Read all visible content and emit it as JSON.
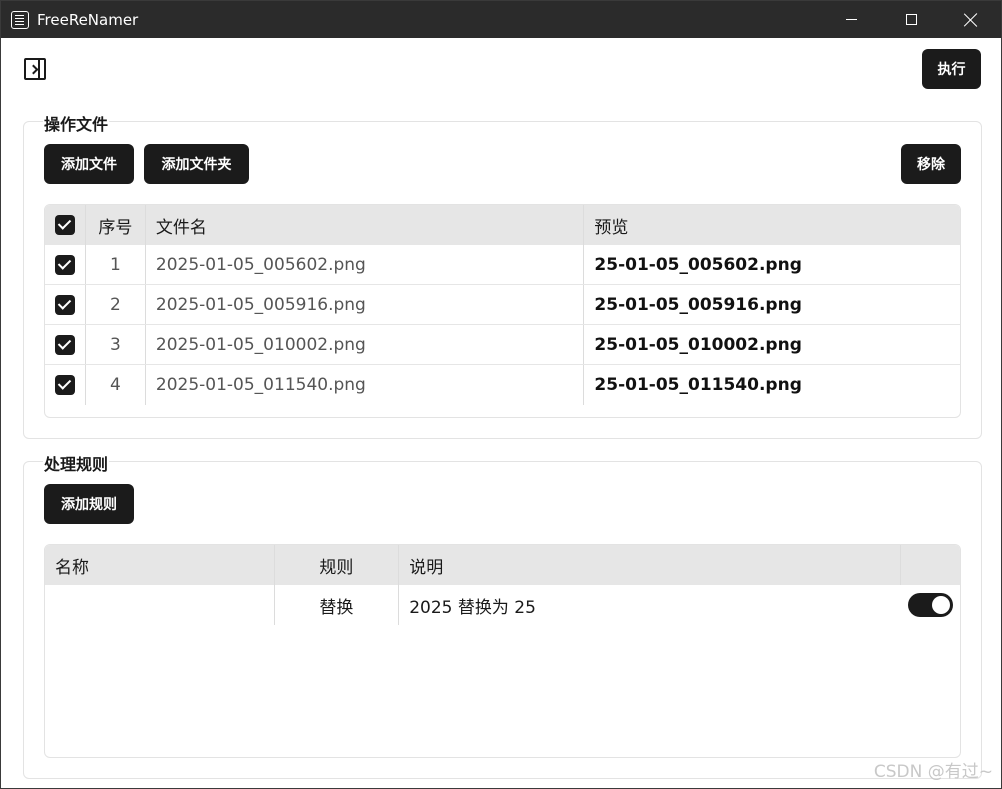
{
  "window": {
    "title": "FreeReNamer",
    "icon": "app-document-icon"
  },
  "toolbar": {
    "execute_label": "执行",
    "sidebar_icon": "sidebar-toggle-icon"
  },
  "files_group": {
    "title": "操作文件",
    "add_file_label": "添加文件",
    "add_folder_label": "添加文件夹",
    "remove_label": "移除",
    "table": {
      "headers": [
        "序号",
        "文件名",
        "预览"
      ],
      "rows": [
        {
          "checked": true,
          "index": "1",
          "name": "2025-01-05_005602.png",
          "preview": "25-01-05_005602.png"
        },
        {
          "checked": true,
          "index": "2",
          "name": "2025-01-05_005916.png",
          "preview": "25-01-05_005916.png"
        },
        {
          "checked": true,
          "index": "3",
          "name": "2025-01-05_010002.png",
          "preview": "25-01-05_010002.png"
        },
        {
          "checked": true,
          "index": "4",
          "name": "2025-01-05_011540.png",
          "preview": "25-01-05_011540.png"
        }
      ]
    }
  },
  "rules_group": {
    "title": "处理规则",
    "add_rule_label": "添加规则",
    "table": {
      "headers": [
        "名称",
        "规则",
        "说明"
      ],
      "rows": [
        {
          "name": "",
          "rule": "替换",
          "description": "2025 替换为 25",
          "enabled": true
        }
      ]
    }
  },
  "watermark": "CSDN @有过~",
  "colors": {
    "titlebar": "#2b2b2b",
    "button": "#1b1b1b",
    "header": "#e6e6e6"
  }
}
